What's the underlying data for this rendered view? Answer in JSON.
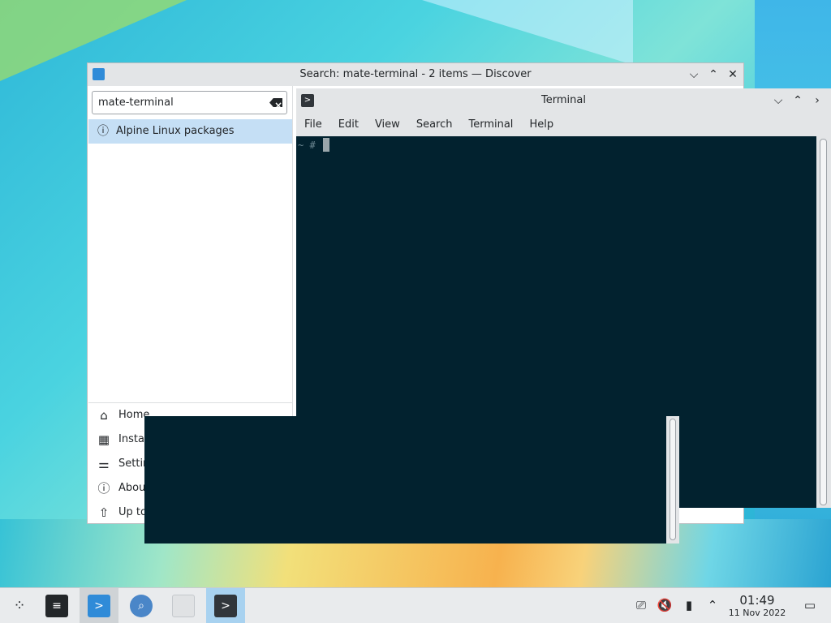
{
  "discover": {
    "title": "Search: mate-terminal - 2 items — Discover",
    "window_controls": [
      "⌵",
      "⌃",
      "✕"
    ],
    "search": {
      "value": "mate-terminal",
      "clear_icon": "backspace-icon"
    },
    "sources": [
      {
        "label": "Alpine Linux packages",
        "icon": "info-icon",
        "selected": true
      }
    ],
    "nav": [
      {
        "label": "Home",
        "icon": "home-icon"
      },
      {
        "label": "Instal",
        "icon": "installed-icon"
      },
      {
        "label": "Settin",
        "icon": "settings-icon"
      },
      {
        "label": "About",
        "icon": "about-icon"
      },
      {
        "label": "Up to",
        "icon": "update-icon"
      }
    ]
  },
  "terminal": {
    "title": "Terminal",
    "window_controls": [
      "⌵",
      "⌃",
      "›",
      "✕"
    ],
    "menu": [
      "File",
      "Edit",
      "View",
      "Search",
      "Terminal",
      "Help"
    ],
    "prompt": "~ #",
    "background": "#02222f"
  },
  "taskbar": {
    "items": [
      {
        "icon": "app-launcher-icon"
      },
      {
        "icon": "system-settings-icon"
      },
      {
        "icon": "discover-icon",
        "active": true
      },
      {
        "icon": "krunner-search-icon"
      },
      {
        "icon": "file-icon"
      },
      {
        "icon": "terminal-icon",
        "active": true
      }
    ],
    "tray": [
      "network-icon",
      "volume-muted-icon",
      "usb-icon",
      "tray-expand-icon"
    ],
    "clock": {
      "time": "01:49",
      "date": "11 Nov 2022"
    },
    "show_desktop_icon": "show-desktop-icon"
  }
}
